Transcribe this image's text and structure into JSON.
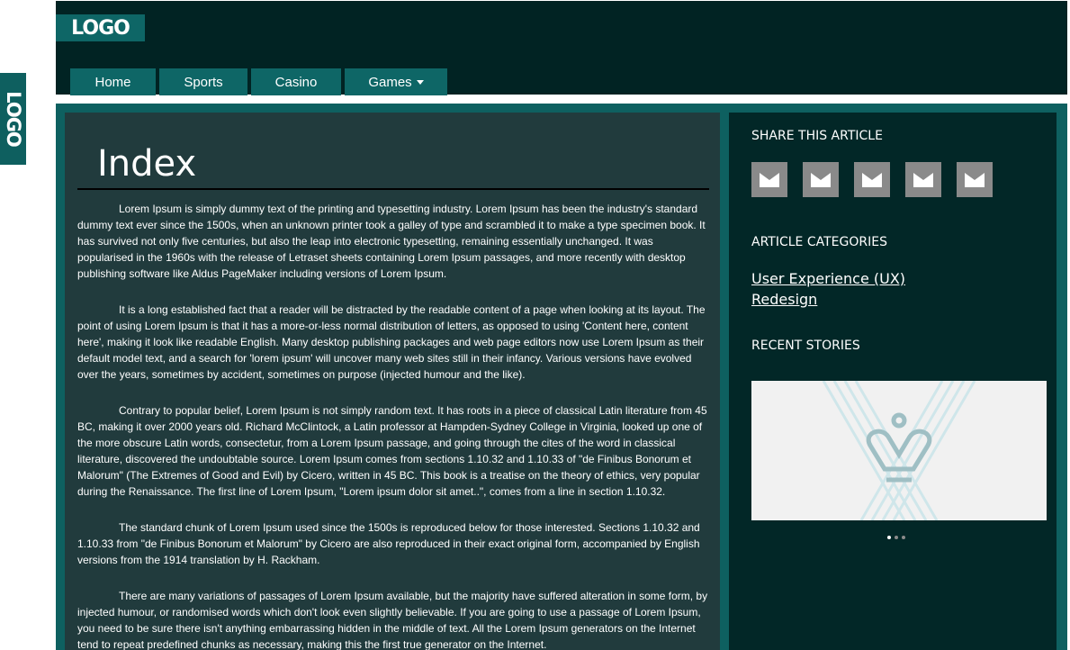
{
  "side_logo": "LOGO",
  "header": {
    "logo": "LOGO",
    "nav": [
      {
        "label": "Home"
      },
      {
        "label": "Sports"
      },
      {
        "label": "Casino"
      },
      {
        "label": "Games"
      }
    ]
  },
  "main": {
    "title": "Index",
    "paragraphs": [
      "Lorem Ipsum is simply dummy text of the printing and typesetting industry. Lorem Ipsum has been the industry's standard dummy text ever since the 1500s, when an unknown printer took a galley of type and scrambled it to make a type specimen book. It has survived not only five centuries, but also the leap into electronic typesetting, remaining essentially unchanged. It was popularised in the 1960s with the release of Letraset sheets containing Lorem Ipsum passages, and more recently with desktop publishing software like Aldus PageMaker including versions of Lorem Ipsum.",
      "It is a long established fact that a reader will be distracted by the readable content of a page when looking at its layout. The point of using Lorem Ipsum is that it has a more-or-less normal distribution of letters, as opposed to using 'Content here, content here', making it look like readable English. Many desktop publishing packages and web page editors now use Lorem Ipsum as their default model text, and a search for 'lorem ipsum' will uncover many web sites still in their infancy. Various versions have evolved over the years, sometimes by accident, sometimes on purpose (injected humour and the like).",
      "Contrary to popular belief, Lorem Ipsum is not simply random text. It has roots in a piece of classical Latin literature from 45 BC, making it over 2000 years old. Richard McClintock, a Latin professor at Hampden-Sydney College in Virginia, looked up one of the more obscure Latin words, consectetur, from a Lorem Ipsum passage, and going through the cites of the word in classical literature, discovered the undoubtable source. Lorem Ipsum comes from sections 1.10.32 and 1.10.33 of \"de Finibus Bonorum et Malorum\" (The Extremes of Good and Evil) by Cicero, written in 45 BC. This book is a treatise on the theory of ethics, very popular during the Renaissance. The first line of Lorem Ipsum, \"Lorem ipsum dolor sit amet..\", comes from a line in section 1.10.32.",
      "The standard chunk of Lorem Ipsum used since the 1500s is reproduced below for those interested. Sections 1.10.32 and 1.10.33 from \"de Finibus Bonorum et Malorum\" by Cicero are also reproduced in their exact original form, accompanied by English versions from the 1914 translation by H. Rackham.",
      "There are many variations of passages of Lorem Ipsum available, but the majority have suffered alteration in some form, by injected humour, or randomised words which don't look even slightly believable. If you are going to use a passage of Lorem Ipsum, you need to be sure there isn't anything embarrassing hidden in the middle of text. All the Lorem Ipsum generators on the Internet tend to repeat predefined chunks as necessary, making this the first true generator on the Internet."
    ]
  },
  "sidebar": {
    "share_heading": "SHARE THIS ARTICLE",
    "share_icons": [
      "envelope-icon",
      "envelope-icon",
      "envelope-icon",
      "envelope-icon",
      "envelope-icon"
    ],
    "categories_heading": "ARTICLE CATEGORIES",
    "categories": [
      "User Experience (UX)",
      "Redesign"
    ],
    "recent_heading": "RECENT STORIES",
    "carousel": {
      "slides": 3,
      "active": 1
    }
  },
  "colors": {
    "accent": "#0e6666",
    "header_bg": "#012323",
    "main_bg": "#213b3d",
    "sidebar_bg": "#022727",
    "share_btn": "#8a8a8a"
  }
}
